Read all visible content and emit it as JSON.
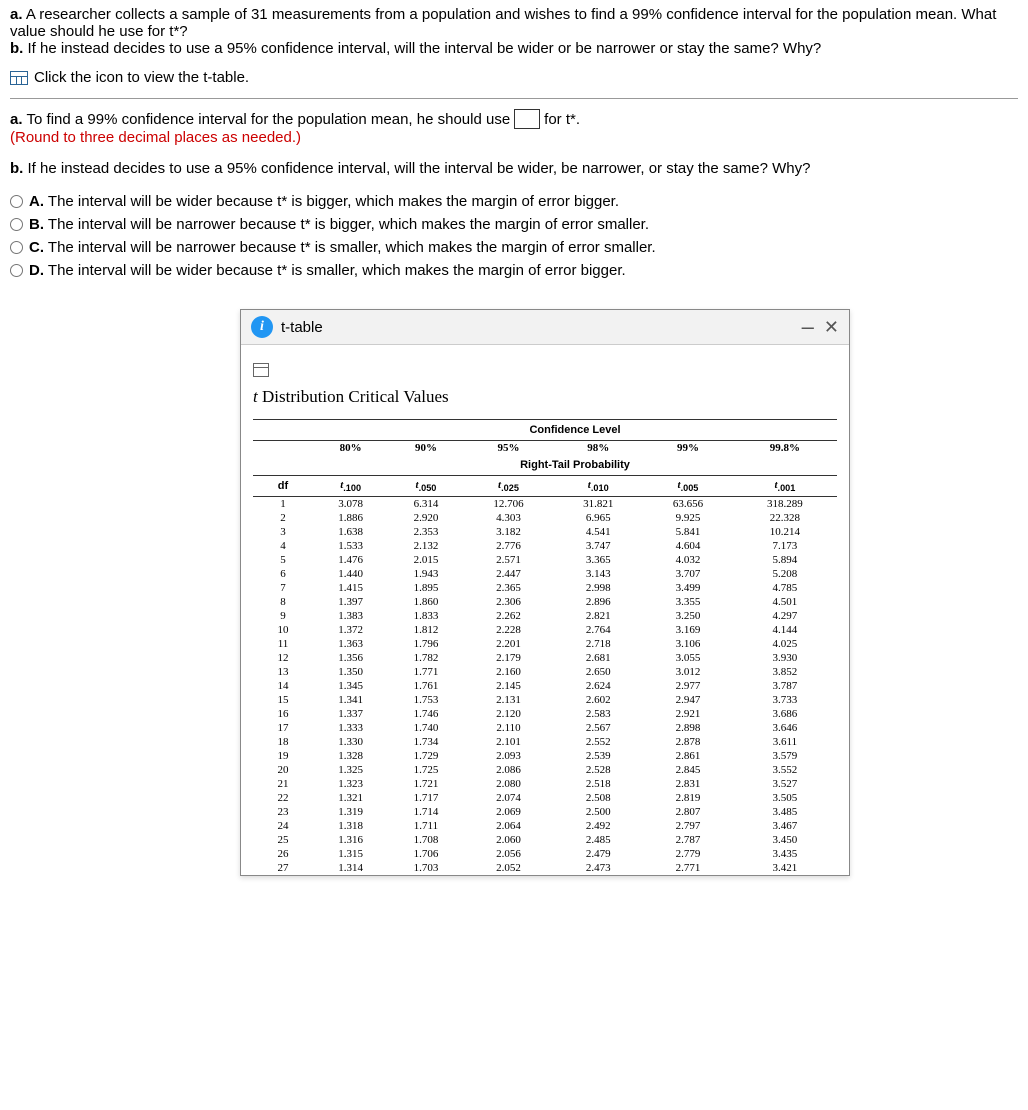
{
  "question": {
    "partA_label": "a.",
    "partA_text": "A researcher collects a sample of 31 measurements from a population and wishes to find a 99% confidence interval for the population mean. What value should he use for t*?",
    "partB_label": "b.",
    "partB_text": "If he instead decides to use a 95% confidence interval, will the interval be wider or be narrower or stay the same? Why?"
  },
  "viewTable": "Click the icon to view the t-table.",
  "partA_answer": {
    "label": "a.",
    "pre": "To find a 99% confidence interval for the population mean, he should use",
    "post": "for t*.",
    "round": "(Round to three decimal places as needed.)"
  },
  "partB_prompt": {
    "label": "b.",
    "text": "If he instead decides to use a 95% confidence interval, will the interval be wider, be narrower, or stay the same? Why?"
  },
  "options": {
    "A": {
      "letter": "A.",
      "text": "The interval will be wider because t* is bigger, which makes the margin of error bigger."
    },
    "B": {
      "letter": "B.",
      "text": "The interval will be narrower because t* is bigger, which makes the margin of error smaller."
    },
    "C": {
      "letter": "C.",
      "text": "The interval will be narrower because t* is smaller, which makes the margin of error smaller."
    },
    "D": {
      "letter": "D.",
      "text": "The interval will be wider because t* is smaller, which makes the margin of error bigger."
    }
  },
  "dialog": {
    "title": "t-table",
    "tableTitle": {
      "prefix_it": "t",
      "rest": " Distribution Critical Values"
    },
    "confLabel": "Confidence Level",
    "rtLabel": "Right-Tail Probability",
    "dfHeader": "df",
    "confHeaders": [
      "80%",
      "90%",
      "95%",
      "98%",
      "99%",
      "99.8%"
    ],
    "tailHeaders": [
      "t.100",
      "t.050",
      "t.025",
      "t.010",
      "t.005",
      "t.001"
    ]
  },
  "chart_data": {
    "type": "table",
    "title": "t Distribution Critical Values",
    "columns": [
      "df",
      "t.100",
      "t.050",
      "t.025",
      "t.010",
      "t.005",
      "t.001"
    ],
    "confidence_levels": [
      "80%",
      "90%",
      "95%",
      "98%",
      "99%",
      "99.8%"
    ],
    "rows": [
      [
        1,
        "3.078",
        "6.314",
        "12.706",
        "31.821",
        "63.656",
        "318.289"
      ],
      [
        2,
        "1.886",
        "2.920",
        "4.303",
        "6.965",
        "9.925",
        "22.328"
      ],
      [
        3,
        "1.638",
        "2.353",
        "3.182",
        "4.541",
        "5.841",
        "10.214"
      ],
      [
        4,
        "1.533",
        "2.132",
        "2.776",
        "3.747",
        "4.604",
        "7.173"
      ],
      [
        5,
        "1.476",
        "2.015",
        "2.571",
        "3.365",
        "4.032",
        "5.894"
      ],
      [
        6,
        "1.440",
        "1.943",
        "2.447",
        "3.143",
        "3.707",
        "5.208"
      ],
      [
        7,
        "1.415",
        "1.895",
        "2.365",
        "2.998",
        "3.499",
        "4.785"
      ],
      [
        8,
        "1.397",
        "1.860",
        "2.306",
        "2.896",
        "3.355",
        "4.501"
      ],
      [
        9,
        "1.383",
        "1.833",
        "2.262",
        "2.821",
        "3.250",
        "4.297"
      ],
      [
        10,
        "1.372",
        "1.812",
        "2.228",
        "2.764",
        "3.169",
        "4.144"
      ],
      [
        11,
        "1.363",
        "1.796",
        "2.201",
        "2.718",
        "3.106",
        "4.025"
      ],
      [
        12,
        "1.356",
        "1.782",
        "2.179",
        "2.681",
        "3.055",
        "3.930"
      ],
      [
        13,
        "1.350",
        "1.771",
        "2.160",
        "2.650",
        "3.012",
        "3.852"
      ],
      [
        14,
        "1.345",
        "1.761",
        "2.145",
        "2.624",
        "2.977",
        "3.787"
      ],
      [
        15,
        "1.341",
        "1.753",
        "2.131",
        "2.602",
        "2.947",
        "3.733"
      ],
      [
        16,
        "1.337",
        "1.746",
        "2.120",
        "2.583",
        "2.921",
        "3.686"
      ],
      [
        17,
        "1.333",
        "1.740",
        "2.110",
        "2.567",
        "2.898",
        "3.646"
      ],
      [
        18,
        "1.330",
        "1.734",
        "2.101",
        "2.552",
        "2.878",
        "3.611"
      ],
      [
        19,
        "1.328",
        "1.729",
        "2.093",
        "2.539",
        "2.861",
        "3.579"
      ],
      [
        20,
        "1.325",
        "1.725",
        "2.086",
        "2.528",
        "2.845",
        "3.552"
      ],
      [
        21,
        "1.323",
        "1.721",
        "2.080",
        "2.518",
        "2.831",
        "3.527"
      ],
      [
        22,
        "1.321",
        "1.717",
        "2.074",
        "2.508",
        "2.819",
        "3.505"
      ],
      [
        23,
        "1.319",
        "1.714",
        "2.069",
        "2.500",
        "2.807",
        "3.485"
      ],
      [
        24,
        "1.318",
        "1.711",
        "2.064",
        "2.492",
        "2.797",
        "3.467"
      ],
      [
        25,
        "1.316",
        "1.708",
        "2.060",
        "2.485",
        "2.787",
        "3.450"
      ],
      [
        26,
        "1.315",
        "1.706",
        "2.056",
        "2.479",
        "2.779",
        "3.435"
      ],
      [
        27,
        "1.314",
        "1.703",
        "2.052",
        "2.473",
        "2.771",
        "3.421"
      ]
    ]
  }
}
